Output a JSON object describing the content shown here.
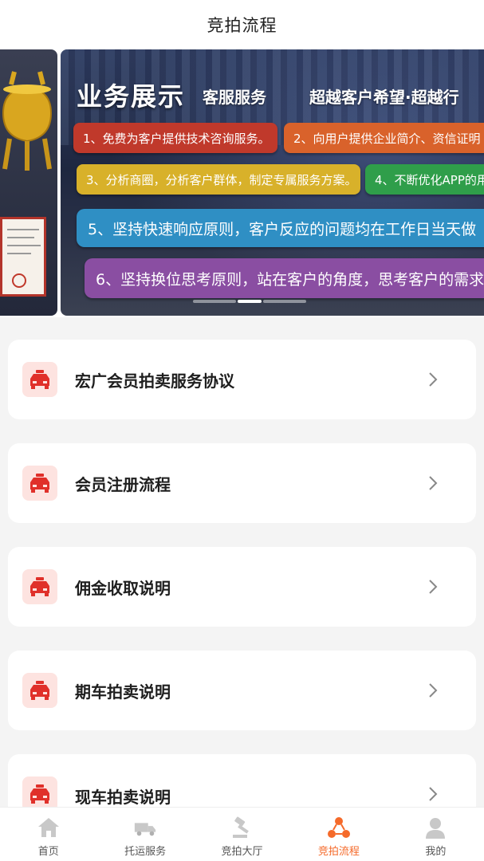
{
  "header": {
    "title": "竞拍流程"
  },
  "banner": {
    "heading": "业务展示",
    "subheading": "客服服务",
    "slogan": "超越客户希望·超越行",
    "items": [
      "1、免费为客户提供技术咨询服务。",
      "2、向用户提供企业简介、资信证明",
      "3、分析商圈，分析客户群体，制定专属服务方案。",
      "4、不断优化APP的用",
      "5、坚持快速响应原则，客户反应的问题均在工作日当天做",
      "6、坚持换位思考原则，站在客户的角度，思考客户的需求"
    ],
    "active_index": 2,
    "slide_count": 3
  },
  "list": [
    {
      "label": "宏广会员拍卖服务协议",
      "icon": "car-icon"
    },
    {
      "label": "会员注册流程",
      "icon": "car-icon"
    },
    {
      "label": "佣金收取说明",
      "icon": "car-icon"
    },
    {
      "label": "期车拍卖说明",
      "icon": "car-icon"
    },
    {
      "label": "现车拍卖说明",
      "icon": "car-icon"
    }
  ],
  "tabbar": [
    {
      "label": "首页",
      "icon": "home-icon"
    },
    {
      "label": "托运服务",
      "icon": "truck-icon"
    },
    {
      "label": "竞拍大厅",
      "icon": "gavel-icon"
    },
    {
      "label": "竞拍流程",
      "icon": "flow-icon",
      "active": true
    },
    {
      "label": "我的",
      "icon": "user-icon"
    }
  ],
  "colors": {
    "accent": "#f56a2a",
    "icon_red": "#e0302a",
    "icon_bg": "#fde3e0"
  }
}
